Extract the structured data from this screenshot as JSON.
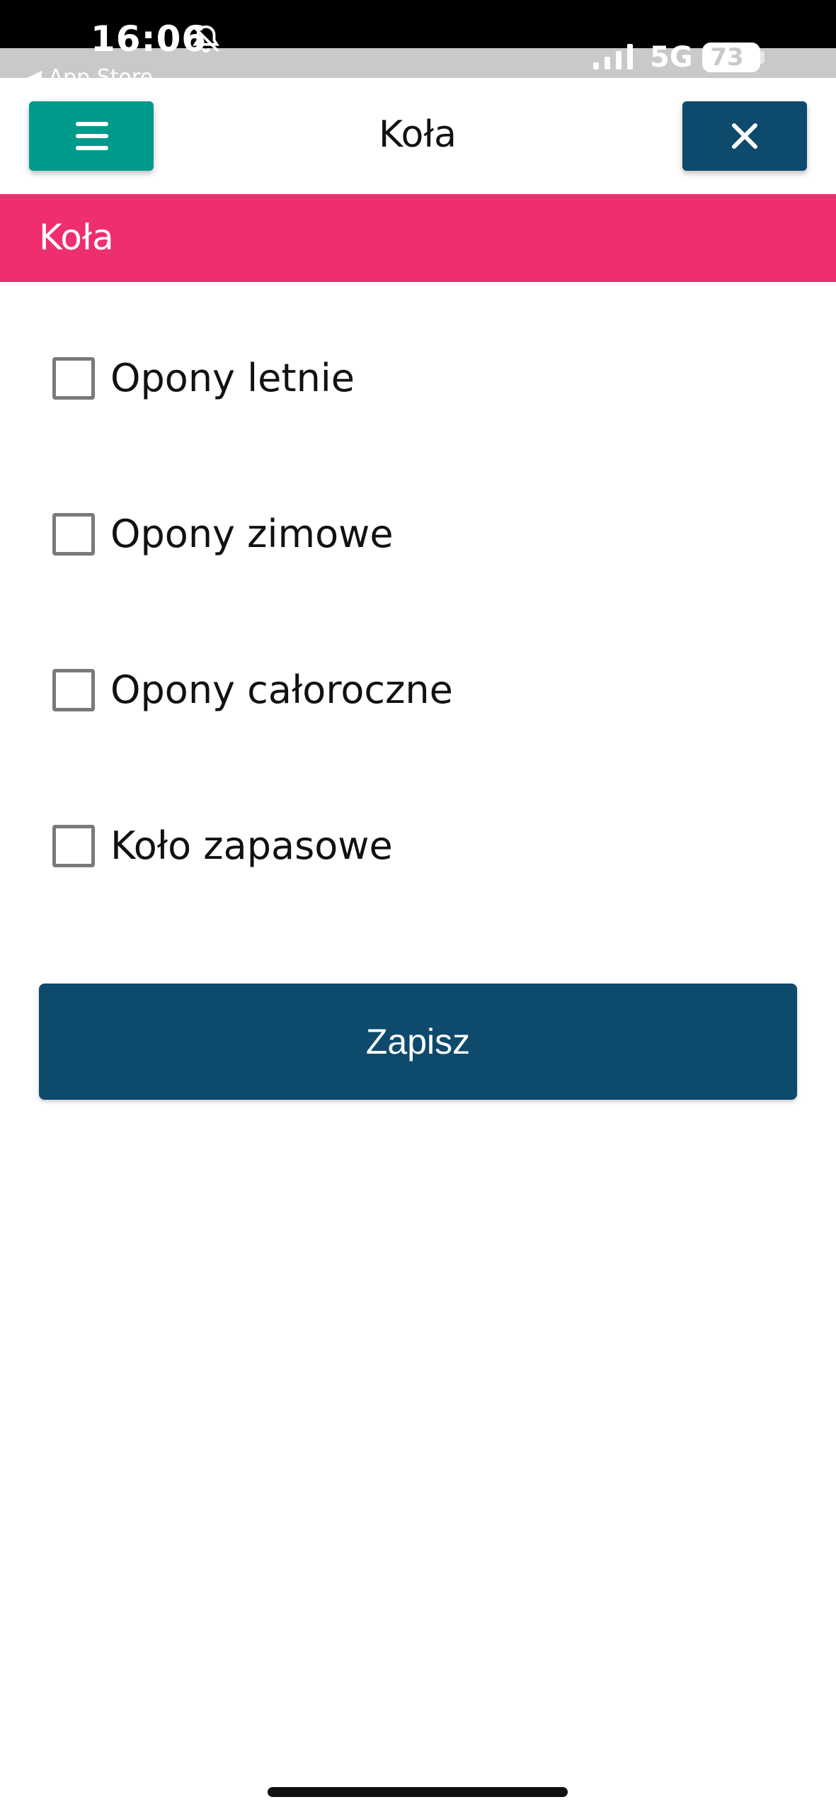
{
  "status_bar": {
    "time": "16:06",
    "back_app": "◀ App Store",
    "network": "5G",
    "battery": "73",
    "icons": {
      "mute": "bell-slash-icon",
      "signal": "signal-bars-icon",
      "battery": "battery-icon"
    }
  },
  "header": {
    "title": "Koła",
    "menu_icon": "hamburger-menu-icon",
    "close_icon": "close-icon"
  },
  "section": {
    "title": "Koła"
  },
  "options": [
    {
      "label": "Opony letnie",
      "checked": false
    },
    {
      "label": "Opony zimowe",
      "checked": false
    },
    {
      "label": "Opony całoroczne",
      "checked": false
    },
    {
      "label": "Koło zapasowe",
      "checked": false
    }
  ],
  "save": {
    "label": "Zapisz"
  },
  "colors": {
    "menu_button": "#009a8c",
    "primary": "#0e4a6c",
    "banner": "#ee2e6e"
  }
}
